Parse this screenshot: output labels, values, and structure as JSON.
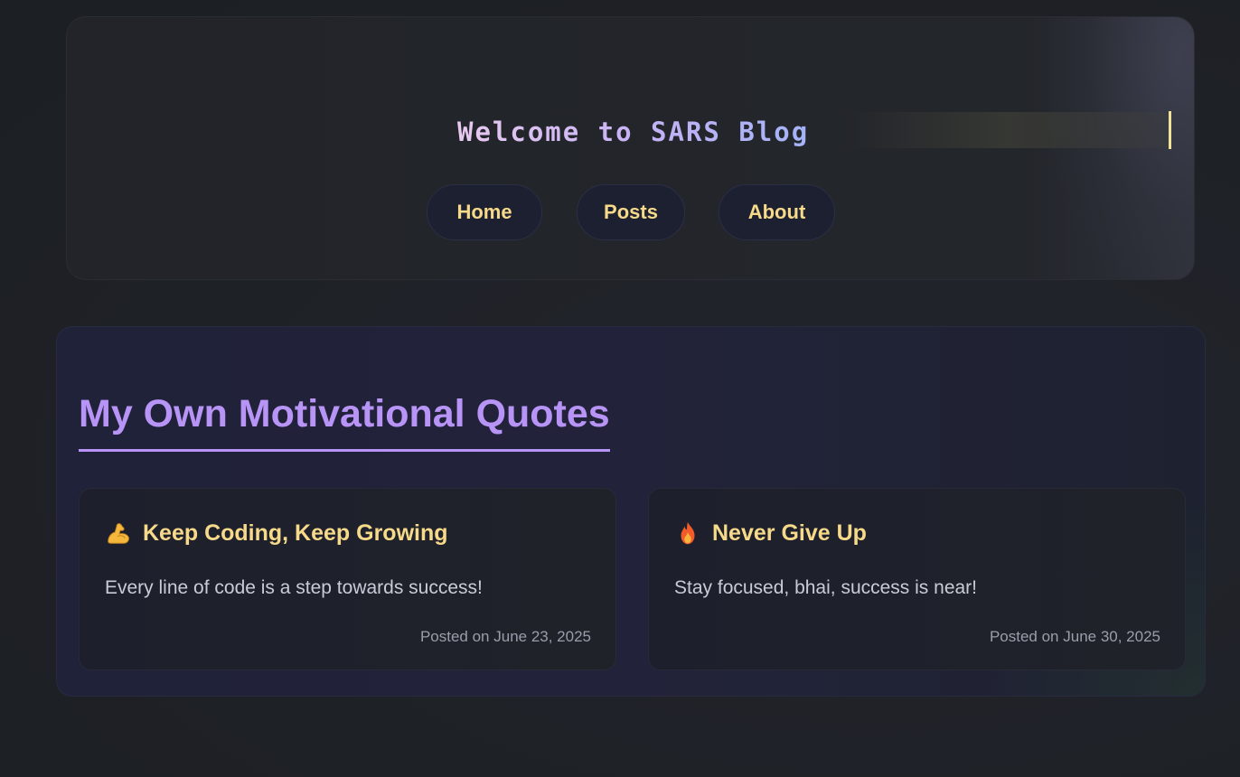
{
  "header": {
    "title": "Welcome to SARS Blog",
    "nav": [
      {
        "label": "Home"
      },
      {
        "label": "Posts"
      },
      {
        "label": "About"
      }
    ]
  },
  "main": {
    "section_title": "My Own Motivational Quotes",
    "posts": [
      {
        "icon": "flexed-biceps-icon",
        "title": "Keep Coding, Keep Growing",
        "body": "Every line of code is a step towards success!",
        "date": "Posted on June 23, 2025"
      },
      {
        "icon": "fire-icon",
        "title": "Never Give Up",
        "body": "Stay focused, bhai, success is near!",
        "date": "Posted on June 30, 2025"
      }
    ]
  },
  "colors": {
    "accent_purple": "#b794f6",
    "accent_yellow": "#f7d98a",
    "cursor": "#f3e29a"
  }
}
